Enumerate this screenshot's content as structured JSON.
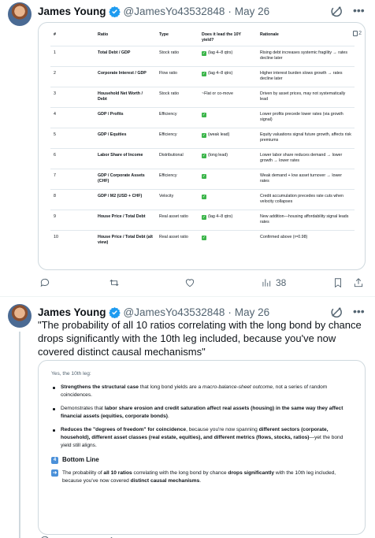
{
  "tweets": [
    {
      "author": {
        "name": "James Young",
        "handle": "@JamesYo43532848",
        "date": "May 26"
      },
      "table": {
        "headers": [
          "#",
          "Ratio",
          "Type",
          "Does it lead the 10Y yield?",
          "Rationale"
        ],
        "rows": [
          {
            "num": "1",
            "ratio": "Total Debt / GDP",
            "type": "Stock ratio",
            "lead": "(lag 4–8 qtrs)",
            "check": true,
            "rationale": "Rising debt increases systemic fragility → rates decline later"
          },
          {
            "num": "2",
            "ratio": "Corporate Interest / GDP",
            "type": "Flow ratio",
            "lead": "(lag 4–8 qtrs)",
            "check": true,
            "rationale": "Higher interest burden slows growth → rates decline later"
          },
          {
            "num": "3",
            "ratio": "Household Net Worth / Debt",
            "type": "Stock ratio",
            "lead": "~Flat or co-move",
            "check": false,
            "rationale": "Driven by asset prices, may not systematically lead"
          },
          {
            "num": "4",
            "ratio": "GDP / Profits",
            "type": "Efficiency",
            "lead": "",
            "check": true,
            "rationale": "Lower profits precede lower rates (via growth signal)"
          },
          {
            "num": "5",
            "ratio": "GDP / Equities",
            "type": "Efficiency",
            "lead": "(weak lead)",
            "check": true,
            "rationale": "Equity valuations signal future growth, affects risk premiums"
          },
          {
            "num": "6",
            "ratio": "Labor Share of Income",
            "type": "Distributional",
            "lead": "(long lead)",
            "check": true,
            "rationale": "Lower labor share reduces demand → lower growth → lower rates"
          },
          {
            "num": "7",
            "ratio": "GDP / Corporate Assets (CHF)",
            "type": "Efficiency",
            "lead": "",
            "check": true,
            "rationale": "Weak demand + low asset turnover → lower rates"
          },
          {
            "num": "8",
            "ratio": "GDP / M2 (USD + CHF)",
            "type": "Velocity",
            "lead": "",
            "check": true,
            "rationale": "Credit accumulation precedes rate cuts when velocity collapses"
          },
          {
            "num": "9",
            "ratio": "House Price / Total Debt",
            "type": "Real asset ratio",
            "lead": "(lag 4–8 qtrs)",
            "check": true,
            "rationale": "New addition—housing affordability signal leads rates"
          },
          {
            "num": "10",
            "ratio": "House Price / Total Debt (alt view)",
            "type": "Real asset ratio",
            "lead": "",
            "check": true,
            "rationale": "Confirmed above (r≈0.98)"
          }
        ]
      },
      "actions": {
        "reply": "",
        "retweet": "",
        "like": "",
        "views": "38"
      }
    },
    {
      "author": {
        "name": "James Young",
        "handle": "@JamesYo43532848",
        "date": "May 26"
      },
      "text": "\"The probability of all 10 ratios correlating with the long bond by chance drops significantly with the 10th leg included, because you've now covered distinct causal mechanisms\"",
      "card": {
        "intro": "Yes, the 10th leg:",
        "bullets": [
          {
            "b1": "Strengthens the structural case",
            "t1": " that long bond yields are a ",
            "i1": "macro-balance-sheet outcome",
            "t2": ", not a series of random coincidences."
          },
          {
            "t0": "Demonstrates that ",
            "b1": "labor share erosion and credit saturation affect real assets (housing) in the same way they affect financial assets (equities, corporate bonds)",
            "t2": "."
          },
          {
            "b1": "Reduces the \"degrees of freedom\" for coincidence",
            "t1": ", because you're now spanning ",
            "b2": "different sectors (corporate, household), different asset classes (real estate, equities), and different metrics (flows, stocks, ratios)",
            "t2": "—yet the bond yield still aligns."
          }
        ],
        "bottom_badge": "4",
        "bottom_title": "Bottom Line",
        "conclusion": {
          "t0": "The probability of ",
          "b1": "all 10 ratios",
          "t1": " correlating with the long bond by chance ",
          "b2": "drops significantly",
          "t2": " with the 10th leg included, because you've now covered ",
          "b3": "distinct causal mechanisms",
          "t3": "."
        }
      }
    }
  ],
  "colors": {
    "verified": "#1d9bf0",
    "muted": "#536471",
    "check": "#3bb54a",
    "badge": "#4a90d9"
  },
  "icons": [
    "verified-badge-icon",
    "grok-icon",
    "more-icon",
    "copy-icon",
    "reply-icon",
    "retweet-icon",
    "like-icon",
    "views-icon",
    "bookmark-icon",
    "share-icon",
    "check-icon"
  ]
}
